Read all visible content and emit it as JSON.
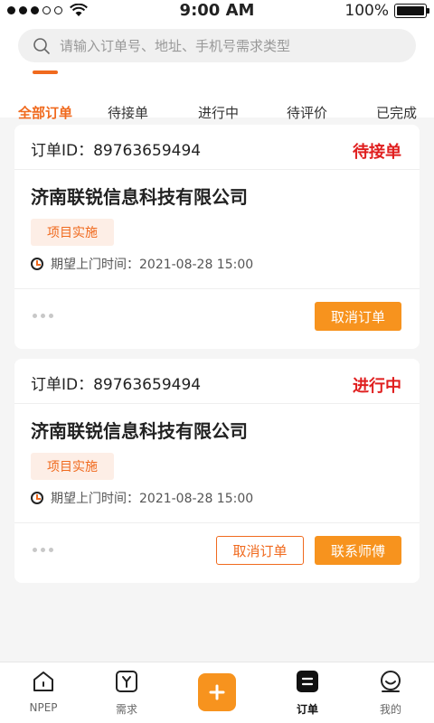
{
  "status_bar": {
    "time": "9:00 AM",
    "battery_text": "100%",
    "battery_level": 1.0
  },
  "search": {
    "placeholder": "请输入订单号、地址、手机号需求类型",
    "icon": "search-icon"
  },
  "tabs": [
    {
      "label": "全部订单",
      "active": true
    },
    {
      "label": "待接单",
      "active": false
    },
    {
      "label": "进行中",
      "active": false
    },
    {
      "label": "待评价",
      "active": false
    },
    {
      "label": "已完成",
      "active": false
    }
  ],
  "orders": [
    {
      "id_text": "订单ID：89763659494",
      "status": "待接单",
      "company": "济南联锐信息科技有限公司",
      "tag": "项目实施",
      "time_text": "期望上门时间：2021-08-28 15:00",
      "buttons": [
        "取消订单"
      ]
    },
    {
      "id_text": "订单ID：89763659494",
      "status": "进行中",
      "company": "济南联锐信息科技有限公司",
      "tag": "项目实施",
      "time_text": "期望上门时间：2021-08-28 15:00",
      "buttons": [
        "取消订单",
        "联系师傅"
      ]
    }
  ],
  "tabbar": [
    {
      "label": "NPEP",
      "icon": "home-icon",
      "active": false
    },
    {
      "label": "需求",
      "icon": "demand-icon",
      "active": false
    },
    {
      "label": "",
      "icon": "plus-icon",
      "active": false
    },
    {
      "label": "订单",
      "icon": "order-icon",
      "active": true
    },
    {
      "label": "我的",
      "icon": "profile-icon",
      "active": false
    }
  ],
  "colors": {
    "accent": "#f06a1e",
    "button": "#f7931e",
    "status_red": "#e01f1f"
  }
}
